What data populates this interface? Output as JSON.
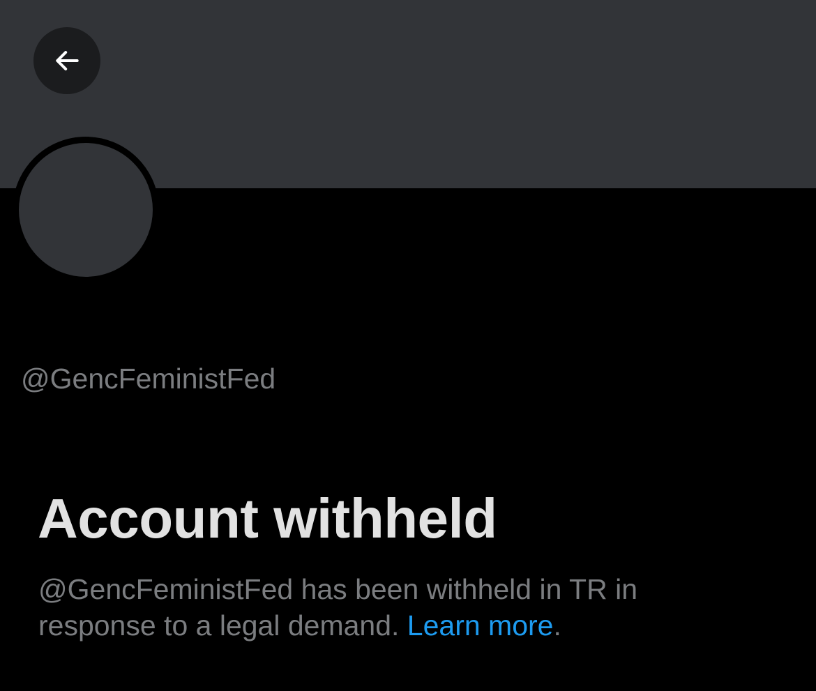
{
  "header": {
    "back_icon": "arrow-left-icon",
    "banner_color": "#323438"
  },
  "profile": {
    "handle": "@GencFeministFed"
  },
  "notice": {
    "title": "Account withheld",
    "message_line1": "@GencFeministFed has been withheld in TR in",
    "message_line2": "response to a legal demand. ",
    "link_label": "Learn more",
    "trailing_period": ".",
    "link_color": "#1d9bf0"
  }
}
